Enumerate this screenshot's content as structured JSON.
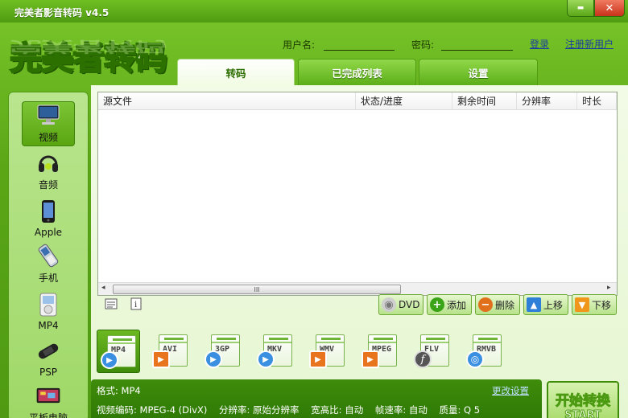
{
  "window": {
    "title": "完美者影音转码 v4.5",
    "min_glyph": "▬",
    "close_glyph": "✕"
  },
  "logo": {
    "text": "完美者转码"
  },
  "login": {
    "username_label": "用户名:",
    "password_label": "密码:",
    "login_link": "登录",
    "register_link": "注册新用户"
  },
  "tabs": [
    {
      "label": "转码",
      "active": true
    },
    {
      "label": "已完成列表",
      "active": false
    },
    {
      "label": "设置",
      "active": false
    }
  ],
  "sidebar": {
    "items": [
      {
        "label": "视频",
        "icon": "monitor-icon",
        "selected": true
      },
      {
        "label": "音频",
        "icon": "headphones-icon",
        "selected": false
      },
      {
        "label": "Apple",
        "icon": "iphone-icon",
        "selected": false
      },
      {
        "label": "手机",
        "icon": "mobile-phone-icon",
        "selected": false
      },
      {
        "label": "MP4",
        "icon": "mp4-player-icon",
        "selected": false
      },
      {
        "label": "PSP",
        "icon": "psp-icon",
        "selected": false
      },
      {
        "label": "平板电脑",
        "icon": "tablet-icon",
        "selected": false
      }
    ]
  },
  "filelist": {
    "columns": [
      "源文件",
      "状态/进度",
      "剩余时间",
      "分辨率",
      "时长"
    ],
    "scroll_grip": "III",
    "scroll_left": "◂",
    "scroll_right": "▸"
  },
  "actions": [
    {
      "label": "DVD",
      "icon": "dvd-icon",
      "color": "#bdbdbd",
      "glyph": "◉"
    },
    {
      "label": "添加",
      "icon": "add-icon",
      "color": "#3aa317",
      "glyph": "+"
    },
    {
      "label": "删除",
      "icon": "remove-icon",
      "color": "#e0701c",
      "glyph": "−"
    },
    {
      "label": "上移",
      "icon": "arrow-up-icon",
      "color": "#2d7fd8",
      "glyph": "▲"
    },
    {
      "label": "下移",
      "icon": "arrow-down-icon",
      "color": "#f0961b",
      "glyph": "▼"
    }
  ],
  "formats": [
    {
      "label": "MP4",
      "badge": "▶",
      "badge_color": "#3a8fe0",
      "selected": true
    },
    {
      "label": "AVI",
      "badge": "▶",
      "badge_color": "#e8751d",
      "selected": false
    },
    {
      "label": "3GP",
      "badge": "▶",
      "badge_color": "#3a8fe0",
      "selected": false
    },
    {
      "label": "MKV",
      "badge": "▶",
      "badge_color": "#3a8fe0",
      "selected": false
    },
    {
      "label": "WMV",
      "badge": "▶",
      "badge_color": "#e8751d",
      "selected": false
    },
    {
      "label": "MPEG",
      "badge": "▶",
      "badge_color": "#e8751d",
      "selected": false
    },
    {
      "label": "FLV",
      "badge": "f",
      "badge_color": "#555555",
      "selected": false
    },
    {
      "label": "RMVB",
      "badge": "◎",
      "badge_color": "#3a8fe0",
      "selected": false
    }
  ],
  "info": {
    "format_line": "格式: MP4",
    "video_line": "视频编码: MPEG-4 (DivX)    分辨率: 原始分辨率    宽高比: 自动    帧速率: 自动    质量: Q 5",
    "change_settings": "更改设置"
  },
  "start_button": {
    "label_cn": "开始转换",
    "label_en": "START"
  },
  "colors": {
    "brand_green": "#5aa617",
    "dark_green": "#2f7a05",
    "link_blue": "#1a3ea0"
  }
}
